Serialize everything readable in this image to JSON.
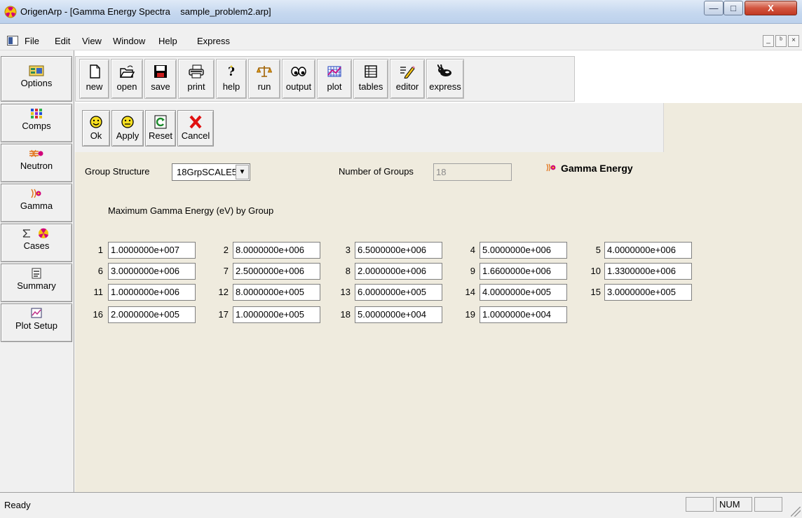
{
  "window": {
    "title": "OrigenArp - [Gamma Energy Spectra    sample_problem2.arp]",
    "min_glyph": "—",
    "max_glyph": "□",
    "close_glyph": "X"
  },
  "menu": {
    "items": [
      "File",
      "Edit",
      "View",
      "Window",
      "Help",
      "Express"
    ],
    "mdi_min": "_",
    "mdi_restore": "ᵇ",
    "mdi_close": "×"
  },
  "sidebar": {
    "items": [
      {
        "label": "Options",
        "icon": "options-icon"
      },
      {
        "label": "Comps",
        "icon": "comps-icon"
      },
      {
        "label": "Neutron",
        "icon": "neutron-icon"
      },
      {
        "label": "Gamma",
        "icon": "gamma-icon"
      },
      {
        "label": "Cases",
        "icon": "cases-icon"
      },
      {
        "label": "Summary",
        "icon": "summary-icon"
      },
      {
        "label": "Plot Setup",
        "icon": "plot-setup-icon"
      }
    ]
  },
  "toolbar": {
    "buttons": [
      {
        "label": "new",
        "icon": "new-file-icon"
      },
      {
        "label": "open",
        "icon": "open-folder-icon"
      },
      {
        "label": "save",
        "icon": "save-disk-icon"
      },
      {
        "label": "print",
        "icon": "printer-icon"
      },
      {
        "label": "help",
        "icon": "help-icon"
      },
      {
        "label": "run",
        "icon": "scales-icon"
      },
      {
        "label": "output",
        "icon": "output-eyes-icon"
      },
      {
        "label": "plot",
        "icon": "plot-grid-icon"
      },
      {
        "label": "tables",
        "icon": "table-icon"
      },
      {
        "label": "editor",
        "icon": "pencil-icon"
      },
      {
        "label": "express",
        "icon": "rabbit-icon"
      }
    ]
  },
  "actions": {
    "buttons": [
      {
        "label": "Ok",
        "icon": "smiley-icon"
      },
      {
        "label": "Apply",
        "icon": "neutral-face-icon"
      },
      {
        "label": "Reset",
        "icon": "refresh-icon"
      },
      {
        "label": "Cancel",
        "icon": "red-x-icon"
      }
    ]
  },
  "form": {
    "group_structure_label": "Group Structure",
    "group_structure_value": "18GrpSCALE5",
    "number_of_groups_label": "Number of Groups",
    "number_of_groups_value": "18",
    "section_heading": "Gamma Energy",
    "table_title": "Maximum Gamma Energy (eV) by Group",
    "groups": [
      {
        "index": "1",
        "value": "1.0000000e+007"
      },
      {
        "index": "2",
        "value": "8.0000000e+006"
      },
      {
        "index": "3",
        "value": "6.5000000e+006"
      },
      {
        "index": "4",
        "value": "5.0000000e+006"
      },
      {
        "index": "5",
        "value": "4.0000000e+006"
      },
      {
        "index": "6",
        "value": "3.0000000e+006"
      },
      {
        "index": "7",
        "value": "2.5000000e+006"
      },
      {
        "index": "8",
        "value": "2.0000000e+006"
      },
      {
        "index": "9",
        "value": "1.6600000e+006"
      },
      {
        "index": "10",
        "value": "1.3300000e+006"
      },
      {
        "index": "11",
        "value": "1.0000000e+006"
      },
      {
        "index": "12",
        "value": "8.0000000e+005"
      },
      {
        "index": "13",
        "value": "6.0000000e+005"
      },
      {
        "index": "14",
        "value": "4.0000000e+005"
      },
      {
        "index": "15",
        "value": "3.0000000e+005"
      },
      {
        "index": "16",
        "value": "2.0000000e+005"
      },
      {
        "index": "17",
        "value": "1.0000000e+005"
      },
      {
        "index": "18",
        "value": "5.0000000e+004"
      },
      {
        "index": "19",
        "value": "1.0000000e+004"
      }
    ]
  },
  "status": {
    "text": "Ready",
    "num": "NUM"
  },
  "colors": {
    "panel": "#efebde",
    "chrome": "#f0f0f0",
    "title_gradient_top": "#dfeaf7",
    "close_red": "#c23a23"
  }
}
